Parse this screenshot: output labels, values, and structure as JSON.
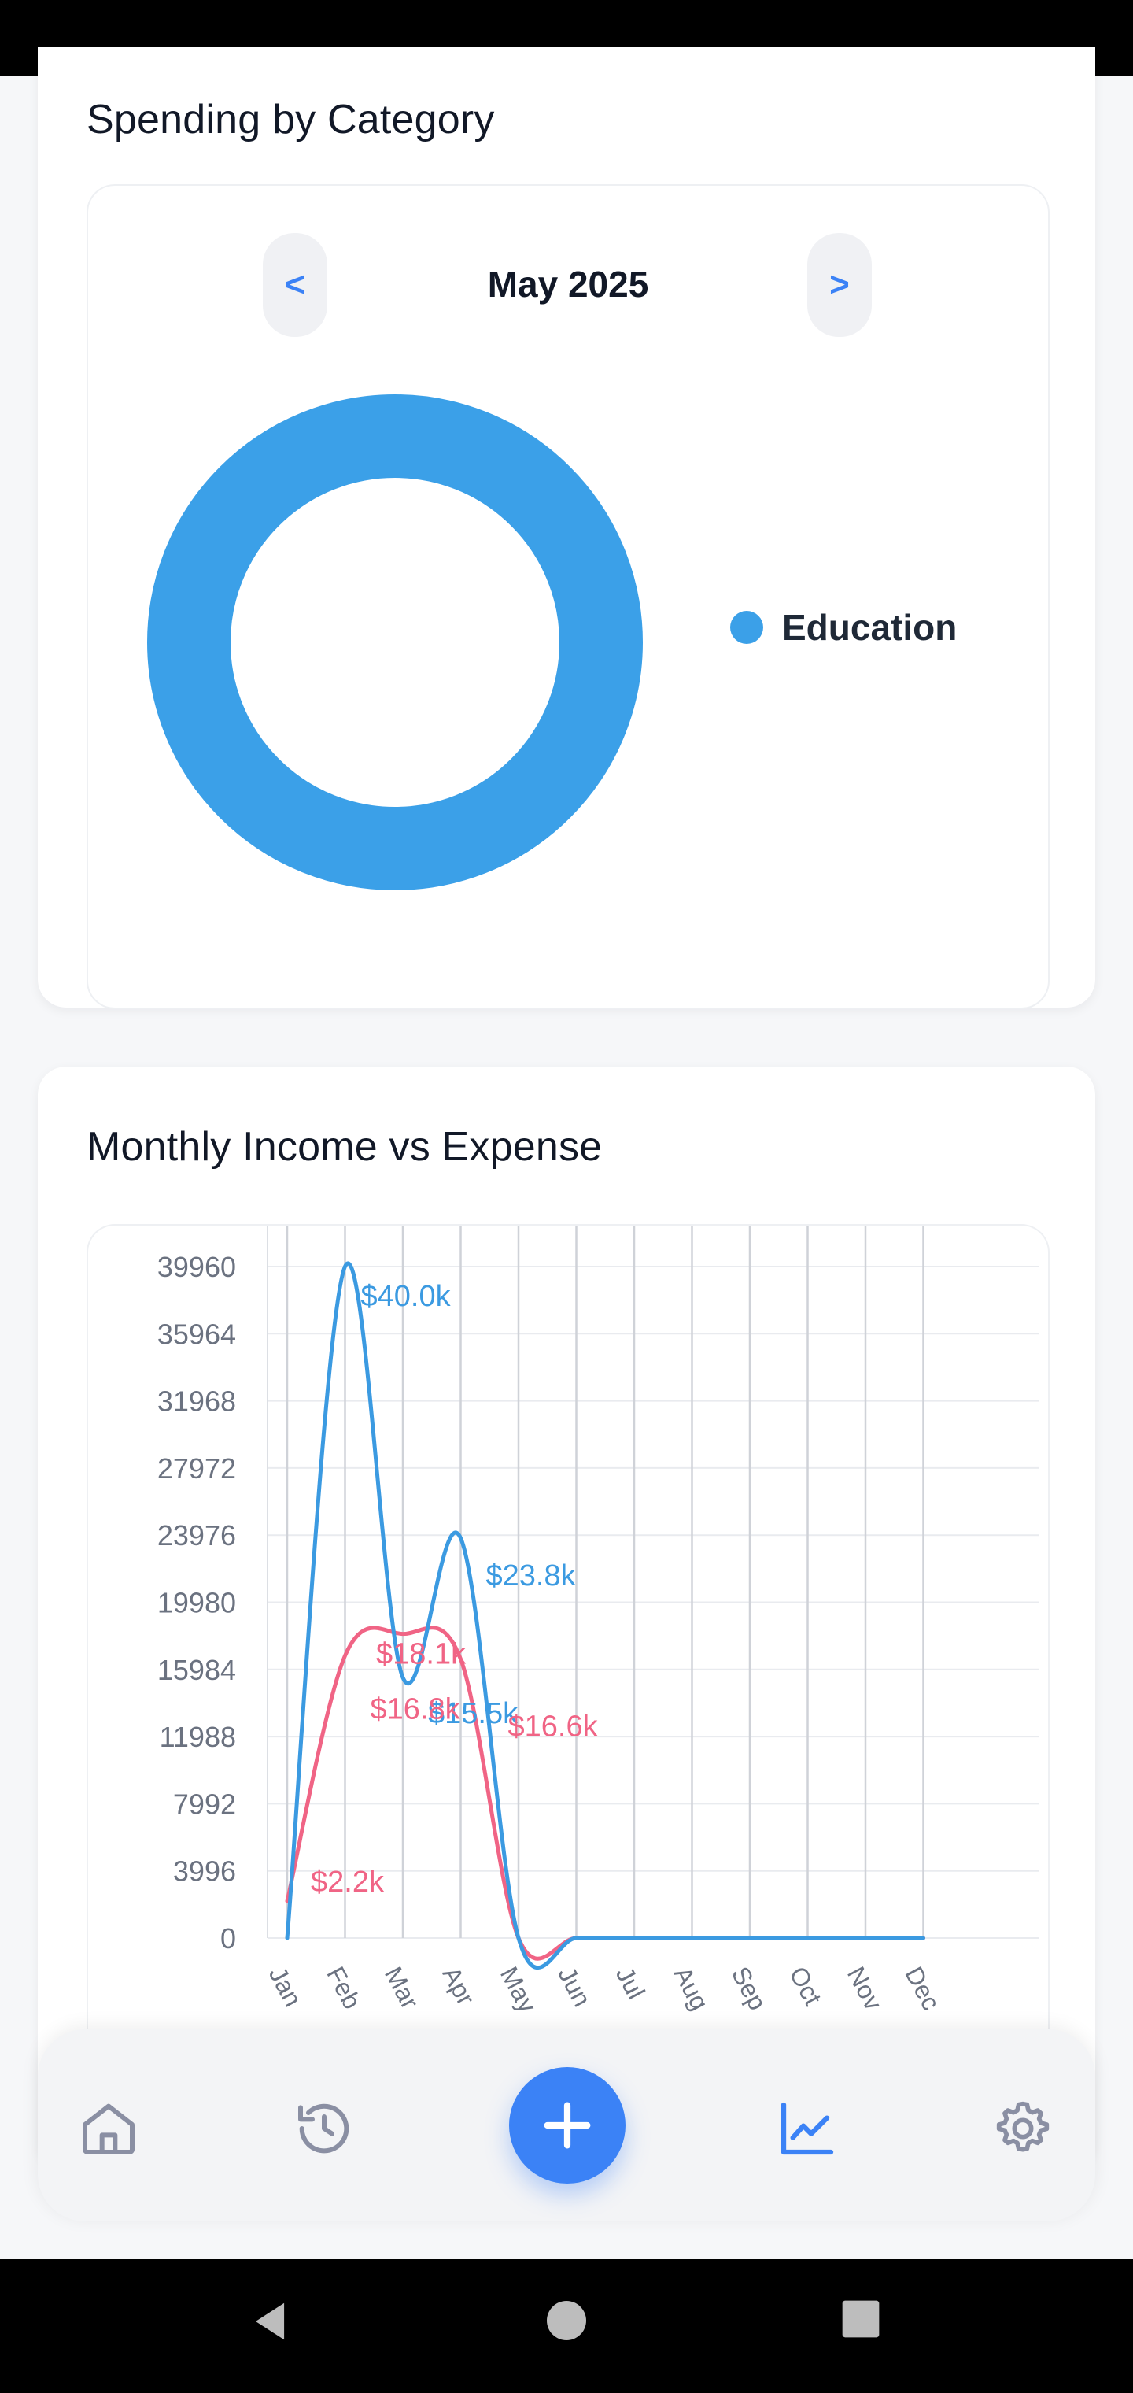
{
  "spending": {
    "title": "Spending by Category",
    "prev_label": "<",
    "next_label": ">",
    "month": "May 2025",
    "categories": [
      {
        "name": "Education",
        "value": 100,
        "color": "#3ba0e8"
      }
    ]
  },
  "income_expense": {
    "title": "Monthly Income vs Expense"
  },
  "chart_data": {
    "type": "line",
    "categories": [
      "Jan",
      "Feb",
      "Mar",
      "Apr",
      "May",
      "Jun",
      "Jul",
      "Aug",
      "Sep",
      "Oct",
      "Nov",
      "Dec"
    ],
    "x_tick_labels": [
      "Jan",
      "Feb",
      "Mar",
      "Apr",
      "May",
      "Jun",
      "Jul",
      "Aug",
      "Sep",
      "Oct",
      "Nov",
      "Dec"
    ],
    "y_ticks": [
      0,
      3996,
      7992,
      11988,
      15984,
      19980,
      23976,
      27972,
      31968,
      35964,
      39960
    ],
    "ylim": [
      0,
      39960
    ],
    "grid": true,
    "series": [
      {
        "color": "#3b9ae1",
        "values": [
          0,
          39960,
          15500,
          23800,
          0,
          0,
          0,
          0,
          0,
          0,
          0,
          0
        ],
        "labels": [
          "",
          "$40.0k",
          "$15.5k",
          "$23.8k",
          "",
          "",
          "",
          "",
          "",
          "",
          "",
          ""
        ]
      },
      {
        "color": "#f06485",
        "values": [
          2200,
          16800,
          18100,
          16600,
          0,
          0,
          0,
          0,
          0,
          0,
          0,
          0
        ],
        "labels": [
          "$2.2k",
          "$16.8k",
          "$18.1k",
          "$16.6k",
          "",
          "",
          "",
          "",
          "",
          "",
          "",
          ""
        ]
      }
    ]
  },
  "bottom_nav": {
    "items": [
      "home-icon",
      "history-icon",
      "add-icon",
      "chart-icon",
      "settings-icon"
    ],
    "active": "chart-icon",
    "accent": "#3b82f6",
    "inactive": "#8a8fa3"
  }
}
